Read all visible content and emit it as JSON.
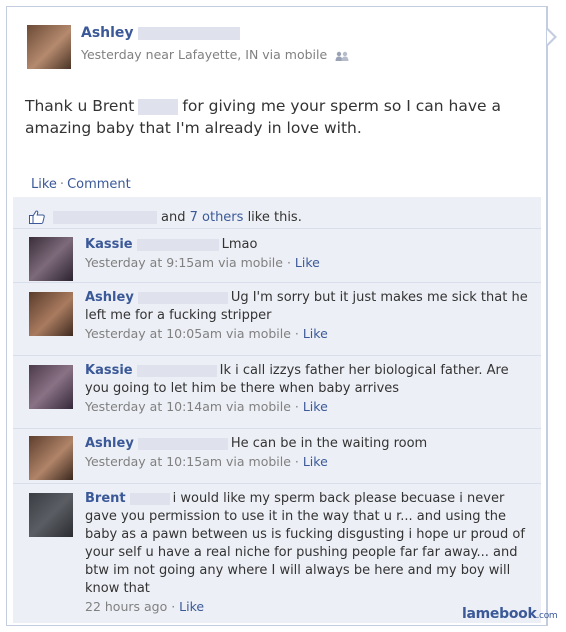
{
  "post": {
    "author": "Ashley",
    "meta": "Yesterday near Lafayette, IN via mobile",
    "status_part1": "Thank u Brent",
    "status_part2": "for giving me your sperm so I can have a amazing baby that I'm already in love with."
  },
  "actions": {
    "like": "Like",
    "separator": "·",
    "comment": "Comment"
  },
  "likes": {
    "and": "and",
    "others": "7 others",
    "suffix": "like this."
  },
  "comments": [
    {
      "name": "Kassie",
      "text": "Lmao",
      "time": "Yesterday at 9:15am via mobile",
      "like": "Like"
    },
    {
      "name": "Ashley",
      "text": "Ug I'm sorry but it just makes me sick that he left me for a fucking stripper",
      "time": "Yesterday at 10:05am via mobile",
      "like": "Like"
    },
    {
      "name": "Kassie",
      "text": "Ik i call izzys father her biological father. Are you going to let him be there when baby arrives",
      "time": "Yesterday at 10:14am via mobile",
      "like": "Like"
    },
    {
      "name": "Ashley",
      "text": "He can be in the waiting room",
      "time": "Yesterday at 10:15am via mobile",
      "like": "Like"
    },
    {
      "name": "Brent",
      "text": "i would like my sperm back please becuase i never gave you permission to use it in the way that u r... and using the baby as a pawn between us is fucking disgusting i hope ur proud of your self u have a real niche for pushing people far far away... and btw im not going any where I will always be here and my boy will know that",
      "time": "22 hours ago",
      "like": "Like"
    }
  ],
  "watermark": {
    "brand": "lamebook",
    "tld": ".com"
  },
  "colors": {
    "link": "#3b5998",
    "feedback_bg": "#eceff5",
    "border": "#c4cde0",
    "meta": "#808080"
  },
  "icons": {
    "friends": "friends-icon",
    "thumb": "thumbs-up-icon"
  }
}
